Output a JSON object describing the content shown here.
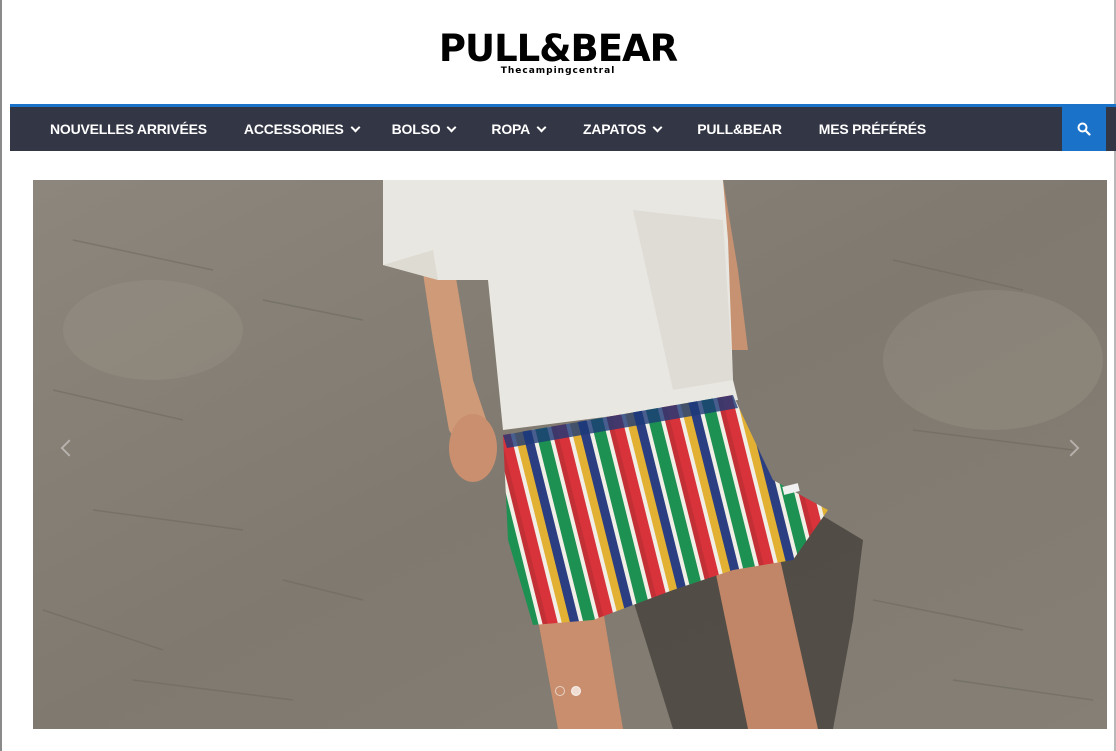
{
  "brand": {
    "name": "PULL&BEAR",
    "tagline": "Thecampingcentral"
  },
  "nav": {
    "items": [
      {
        "label": "NOUVELLES ARRIVÉES",
        "dropdown": false
      },
      {
        "label": "ACCESSORIES",
        "dropdown": true
      },
      {
        "label": "BOLSO",
        "dropdown": true
      },
      {
        "label": "ROPA",
        "dropdown": true
      },
      {
        "label": "ZAPATOS",
        "dropdown": true
      },
      {
        "label": "PULL&BEAR",
        "dropdown": false
      },
      {
        "label": "MES PRÉFÉRÉS",
        "dropdown": false
      }
    ],
    "search_icon": "search-icon"
  },
  "colors": {
    "nav_background": "#333645",
    "accent": "#1a73c9",
    "text_on_nav": "#ffffff"
  },
  "slider": {
    "slide_count": 2,
    "active_slide": 2,
    "image": "model in white t-shirt and multicolor striped shorts against concrete wall"
  }
}
